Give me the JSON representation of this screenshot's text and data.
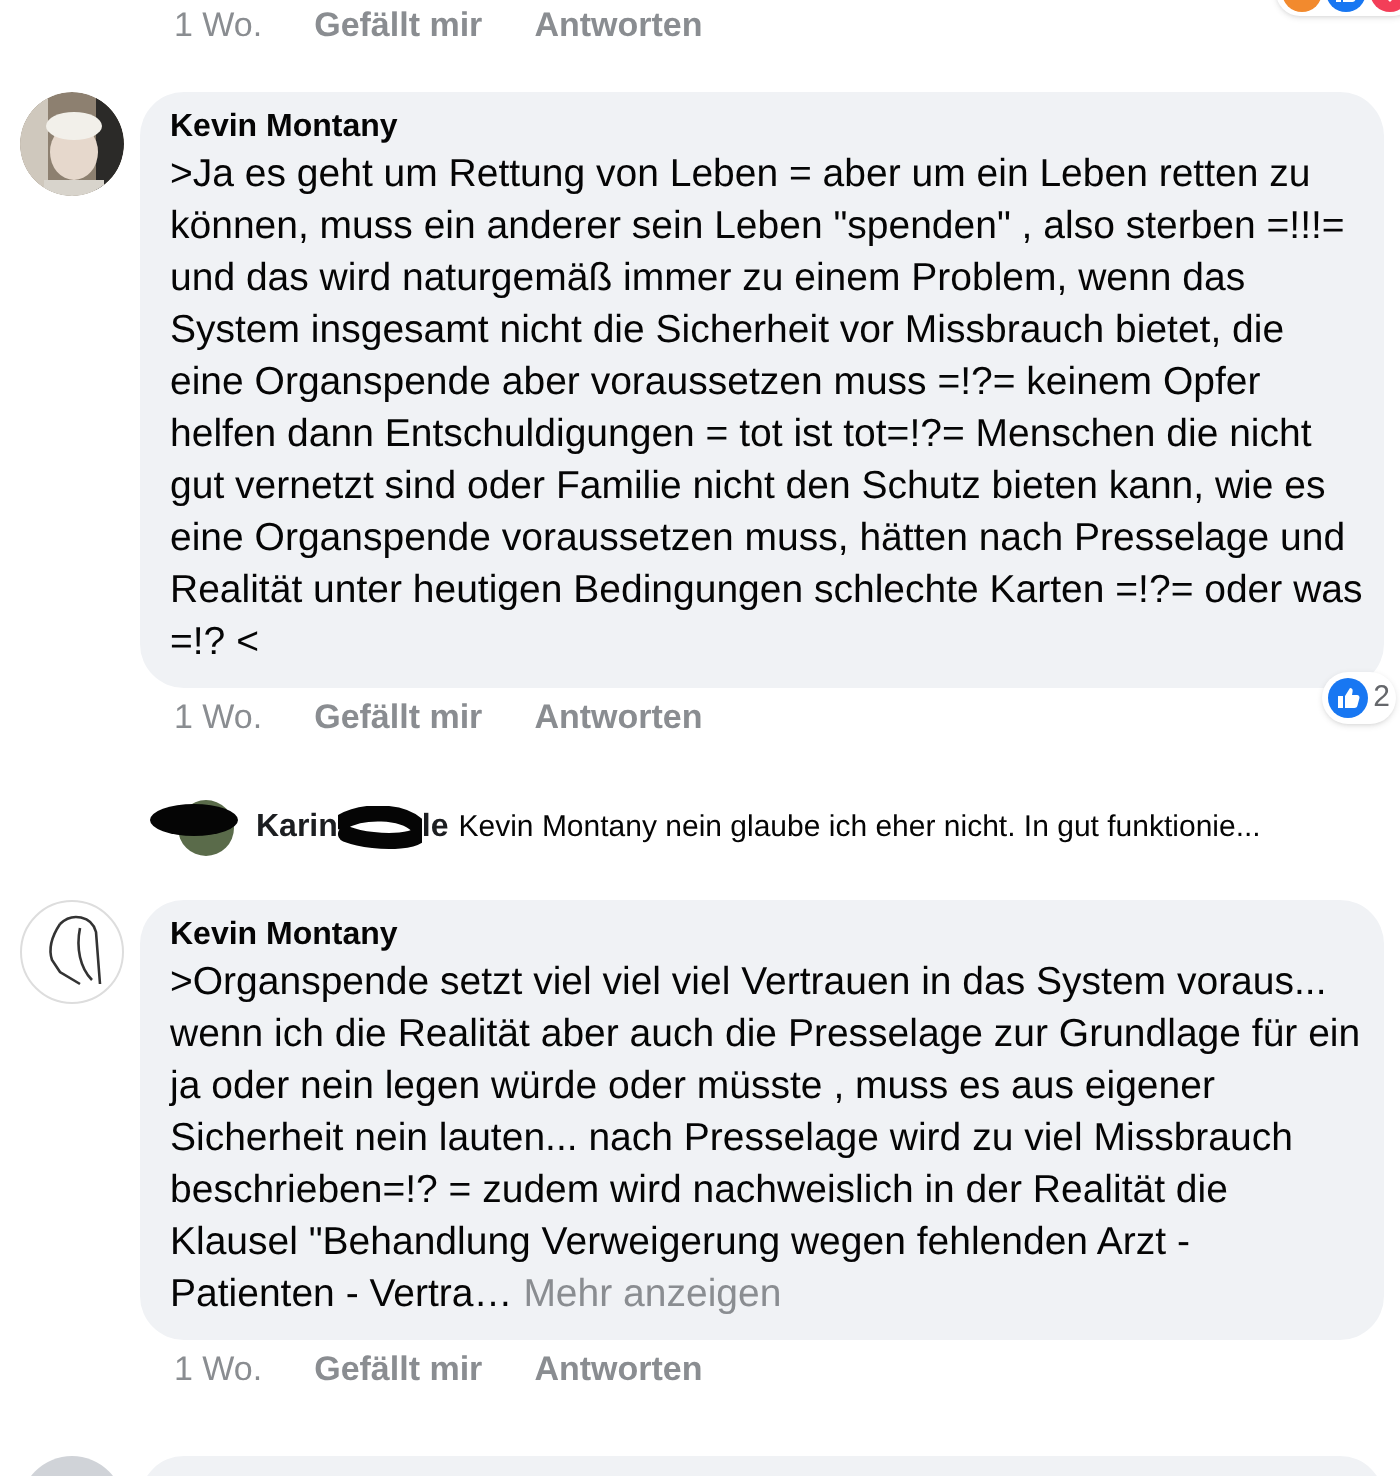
{
  "top_actions": {
    "time": "1 Wo.",
    "like": "Gefällt mir",
    "reply": "Antworten"
  },
  "comments": [
    {
      "kind": "full",
      "avatar": {
        "kind": "photo"
      },
      "author": "Kevin Montany",
      "text": ">Ja es geht um Rettung von Leben = aber um ein Leben retten zu können, muss ein anderer sein Leben \"spenden\" , also sterben =!!!= und das wird naturgemäß immer zu einem Problem, wenn das System insgesamt nicht die Sicherheit vor Missbrauch bietet, die eine Organspende aber voraussetzen muss =!?= keinem Opfer helfen dann Entschuldigungen = tot ist tot=!?= Menschen die nicht gut vernetzt sind oder Familie nicht den Schutz bieten kann, wie es eine Organspende voraussetzen muss, hätten nach Presselage und Realität unter heutigen Bedingungen schlechte Karten =!?= oder was =!? <",
      "time": "1 Wo.",
      "like": "Gefällt mir",
      "reply": "Antworten",
      "reaction_count": "2"
    },
    {
      "kind": "reply_preview",
      "author": "Karin",
      "author_tail": "le",
      "text": "Kevin Montany nein glaube ich eher nicht. In gut funktionie..."
    },
    {
      "kind": "full",
      "avatar": {
        "kind": "sketch"
      },
      "author": "Kevin Montany",
      "text": ">Organspende setzt viel viel viel Vertrauen in das System voraus... wenn ich die Realität aber auch die Presselage zur Grundlage für ein  ja oder nein legen würde oder müsste , muss es aus eigener Sicherheit  nein  lauten... nach Presselage wird zu viel Missbrauch beschrieben=!? = zudem wird nachweislich in der Realität die Klausel \"Behandlung Verweigerung wegen fehlenden Arzt - Patienten - Vertra…",
      "more": "Mehr anzeigen",
      "time": "1 Wo.",
      "like": "Gefällt mir",
      "reply": "Antworten"
    },
    {
      "kind": "cut",
      "avatar": {
        "kind": "default"
      }
    }
  ]
}
